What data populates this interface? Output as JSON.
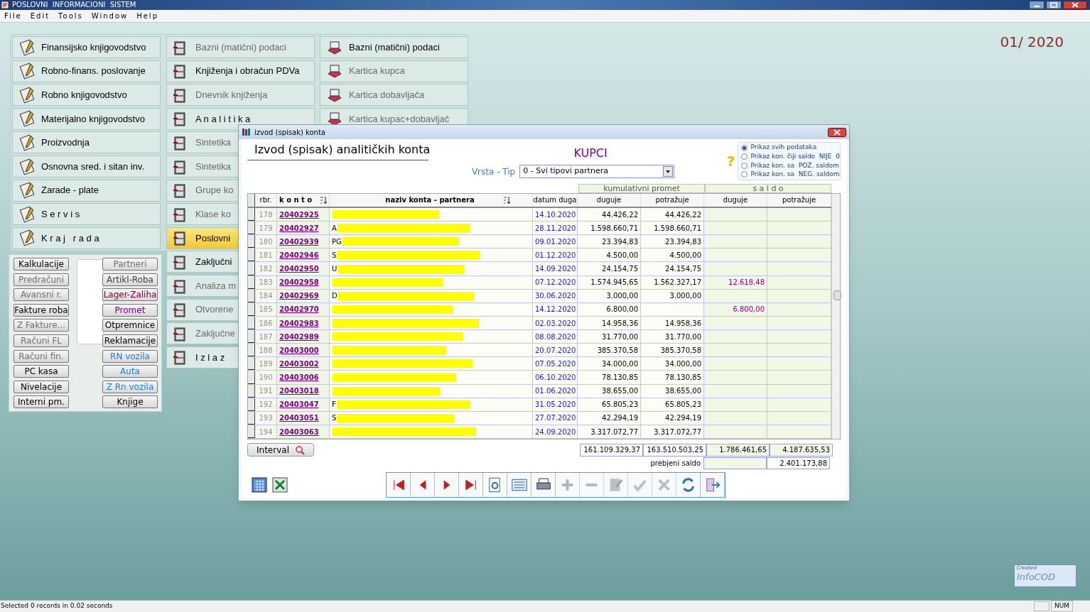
{
  "window": {
    "title": "POSLOVNI  INFORMACIONI  SISTEM"
  },
  "menu_bar": [
    "File",
    "Edit",
    "Tools",
    "Window",
    "Help"
  ],
  "period": "01/ 2020",
  "main_menu": {
    "columns": [
      [
        {
          "label": "Finansijsko knjigovodstvo",
          "disabled": false,
          "selected": false
        },
        {
          "label": "Robno-finans. poslovanje",
          "disabled": false,
          "selected": false
        },
        {
          "label": "Robno knjigovodstvo",
          "disabled": false,
          "selected": false
        },
        {
          "label": "Materijalno knjigovodstvo",
          "disabled": false,
          "selected": false
        },
        {
          "label": "Proizvodnja",
          "disabled": false,
          "selected": false
        },
        {
          "label": "Osnovna sred. i sitan inv.",
          "disabled": false,
          "selected": false
        },
        {
          "label": "Zarade - plate",
          "disabled": false,
          "selected": false
        },
        {
          "label": "S e r v i s",
          "disabled": false,
          "selected": false
        },
        {
          "label": "K r a j   r a d a",
          "disabled": false,
          "selected": false
        }
      ],
      [
        {
          "label": "Bazni (matični) podaci",
          "disabled": true,
          "selected": false
        },
        {
          "label": "Knjiženja i obračun PDVa",
          "disabled": false,
          "selected": false
        },
        {
          "label": "Dnevnik knjiženja",
          "disabled": true,
          "selected": false
        },
        {
          "label": "A n a l i t i k a",
          "disabled": false,
          "selected": false
        },
        {
          "label": "Sintetika",
          "disabled": true,
          "selected": false
        },
        {
          "label": "Sintetika",
          "disabled": true,
          "selected": false
        },
        {
          "label": "Grupe ko",
          "disabled": true,
          "selected": false
        },
        {
          "label": "Klase ko",
          "disabled": true,
          "selected": false
        },
        {
          "label": "Poslovni",
          "disabled": false,
          "selected": true
        },
        {
          "label": "Zaključni",
          "disabled": false,
          "selected": false
        },
        {
          "label": "Analiza m",
          "disabled": true,
          "selected": false
        },
        {
          "label": "Otvorene",
          "disabled": true,
          "selected": false
        },
        {
          "label": "Zaključne",
          "disabled": true,
          "selected": false
        },
        {
          "label": "I z l a z",
          "disabled": false,
          "selected": false
        }
      ],
      [
        {
          "label": "Bazni (matični) podaci",
          "disabled": false,
          "selected": false
        },
        {
          "label": "Kartica kupca",
          "disabled": true,
          "selected": false
        },
        {
          "label": "Kartica dobavljača",
          "disabled": true,
          "selected": false
        },
        {
          "label": "Kartica kupac+dobavljač",
          "disabled": true,
          "selected": false
        }
      ]
    ]
  },
  "quick_buttons": {
    "left": [
      {
        "label": "Kalkulacije",
        "color": "#000000"
      },
      {
        "label": "Predračuni",
        "color": "#707070"
      },
      {
        "label": "Avansni r.",
        "color": "#707070"
      },
      {
        "label": "Fakture roba",
        "color": "#000000"
      },
      {
        "label": "Z Fakture...",
        "color": "#707070"
      },
      {
        "label": "Računi FL",
        "color": "#707070"
      },
      {
        "label": "Računi fin.",
        "color": "#707070"
      },
      {
        "label": "PC kasa",
        "color": "#000000"
      },
      {
        "label": "Nivelacije",
        "color": "#000000"
      },
      {
        "label": "Interni pm.",
        "color": "#000000"
      }
    ],
    "right": [
      {
        "label": "Partneri",
        "color": "#707070"
      },
      {
        "label": "Artikl-Roba",
        "color": "#404040"
      },
      {
        "label": "Lager-Zaliha",
        "color": "#800040"
      },
      {
        "label": "Promet",
        "color": "#800080"
      },
      {
        "label": "Otpremnice",
        "color": "#000000"
      },
      {
        "label": "Reklamacije",
        "color": "#000000"
      },
      {
        "label": "RN vozila",
        "color": "#1a7fc8"
      },
      {
        "label": "Auta",
        "color": "#1a7fc8"
      },
      {
        "label": "Z Rn vozila",
        "color": "#1a7fc8"
      },
      {
        "label": "Knjige",
        "color": "#000000"
      }
    ]
  },
  "dialog": {
    "title": "izvod (spisak) konta",
    "heading": "Izvod (spisak) analitičkih konta",
    "category": "KUPCI",
    "help_symbol": "?",
    "type_label": "Vrsta - Tip",
    "type_value": "0 - Svi tipovi partnera",
    "filters": [
      {
        "label": "Prikaz svih podataka",
        "selected": true
      },
      {
        "label": "Prikaz kon. čiji saldo  NIJE  0",
        "selected": false
      },
      {
        "label": "Prikaz kon. sa  POZ. saldom",
        "selected": false
      },
      {
        "label": "Prikaz kon. sa  NEG. saldom",
        "selected": false
      }
    ],
    "group_headers": [
      "kumulativni promet",
      "s a l d o"
    ],
    "columns": [
      "rbr.",
      "k o n t o",
      "naziv konta - partnera",
      "datum duga",
      "duguje",
      "potražuje",
      "duguje",
      "potražuje"
    ],
    "rows": [
      {
        "rbr": "178",
        "konto": "20402925",
        "partner": "",
        "date": "14.10.2020",
        "debit": "44.426,22",
        "credit": "44.426,22",
        "saldo_debit": "",
        "saldo_credit": ""
      },
      {
        "rbr": "179",
        "konto": "20402927",
        "partner": "A",
        "date": "28.11.2020",
        "debit": "1.598.660,71",
        "credit": "1.598.660,71",
        "saldo_debit": "",
        "saldo_credit": ""
      },
      {
        "rbr": "180",
        "konto": "20402939",
        "partner": "PG",
        "date": "09.01.2020",
        "debit": "23.394,83",
        "credit": "23.394,83",
        "saldo_debit": "",
        "saldo_credit": ""
      },
      {
        "rbr": "181",
        "konto": "20402946",
        "partner": "S",
        "date": "01.12.2020",
        "debit": "4.500,00",
        "credit": "4.500,00",
        "saldo_debit": "",
        "saldo_credit": ""
      },
      {
        "rbr": "182",
        "konto": "20402950",
        "partner": "U",
        "date": "14.09.2020",
        "debit": "24.154,75",
        "credit": "24.154,75",
        "saldo_debit": "",
        "saldo_credit": ""
      },
      {
        "rbr": "183",
        "konto": "20402958",
        "partner": "",
        "date": "07.12.2020",
        "debit": "1.574.945,65",
        "credit": "1.562.327,17",
        "saldo_debit": "12.618,48",
        "saldo_credit": ""
      },
      {
        "rbr": "184",
        "konto": "20402969",
        "partner": "D",
        "date": "30.06.2020",
        "debit": "3.000,00",
        "credit": "3.000,00",
        "saldo_debit": "",
        "saldo_credit": ""
      },
      {
        "rbr": "185",
        "konto": "20402970",
        "partner": "",
        "date": "14.12.2020",
        "debit": "6.800,00",
        "credit": "",
        "saldo_debit": "6.800,00",
        "saldo_credit": ""
      },
      {
        "rbr": "186",
        "konto": "20402983",
        "partner": "",
        "date": "02.03.2020",
        "debit": "14.958,36",
        "credit": "14.958,36",
        "saldo_debit": "",
        "saldo_credit": ""
      },
      {
        "rbr": "187",
        "konto": "20402989",
        "partner": "",
        "date": "08.08.2020",
        "debit": "31.770,00",
        "credit": "31.770,00",
        "saldo_debit": "",
        "saldo_credit": ""
      },
      {
        "rbr": "188",
        "konto": "20403000",
        "partner": "",
        "date": "20.07.2020",
        "debit": "385.370,58",
        "credit": "385.370,58",
        "saldo_debit": "",
        "saldo_credit": ""
      },
      {
        "rbr": "189",
        "konto": "20403002",
        "partner": "",
        "date": "07.05.2020",
        "debit": "34.000,00",
        "credit": "34.000,00",
        "saldo_debit": "",
        "saldo_credit": ""
      },
      {
        "rbr": "190",
        "konto": "20403006",
        "partner": "",
        "date": "06.10.2020",
        "debit": "78.130,85",
        "credit": "78.130,85",
        "saldo_debit": "",
        "saldo_credit": ""
      },
      {
        "rbr": "191",
        "konto": "20403018",
        "partner": "",
        "date": "01.06.2020",
        "debit": "38.655,00",
        "credit": "38.655,00",
        "saldo_debit": "",
        "saldo_credit": ""
      },
      {
        "rbr": "192",
        "konto": "20403047",
        "partner": "F",
        "date": "31.05.2020",
        "debit": "65.805,23",
        "credit": "65.805,23",
        "saldo_debit": "",
        "saldo_credit": ""
      },
      {
        "rbr": "193",
        "konto": "20403051",
        "partner": "S",
        "date": "27.07.2020",
        "debit": "42.294,19",
        "credit": "42.294,19",
        "saldo_debit": "",
        "saldo_credit": ""
      },
      {
        "rbr": "194",
        "konto": "20403063",
        "partner": "",
        "date": "24.09.2020",
        "debit": "3.317.072,77",
        "credit": "3.317.072,77",
        "saldo_debit": "",
        "saldo_credit": ""
      }
    ],
    "interval_button": "Interval",
    "totals": [
      "161.109.329,37",
      "163.510.503,25",
      "1.786.461,65",
      "4.187.635,53"
    ],
    "net_saldo_label": "prebjeni saldo",
    "net_saldo": "2.401.173,88",
    "toolbar": [
      {
        "disabled": false
      },
      {
        "disabled": false
      },
      {
        "disabled": false
      },
      {
        "disabled": false
      },
      {
        "disabled": false
      },
      {
        "disabled": false
      },
      {
        "disabled": false
      },
      {
        "disabled": true
      },
      {
        "disabled": true
      },
      {
        "disabled": true
      },
      {
        "disabled": true
      },
      {
        "disabled": true
      },
      {
        "disabled": false
      },
      {
        "disabled": false
      }
    ]
  },
  "logo": {
    "caption": "Created",
    "name": "InfoCOD"
  },
  "status_bar": {
    "message": "Selected 0 records in 0.02 seconds",
    "num": "NUM"
  }
}
